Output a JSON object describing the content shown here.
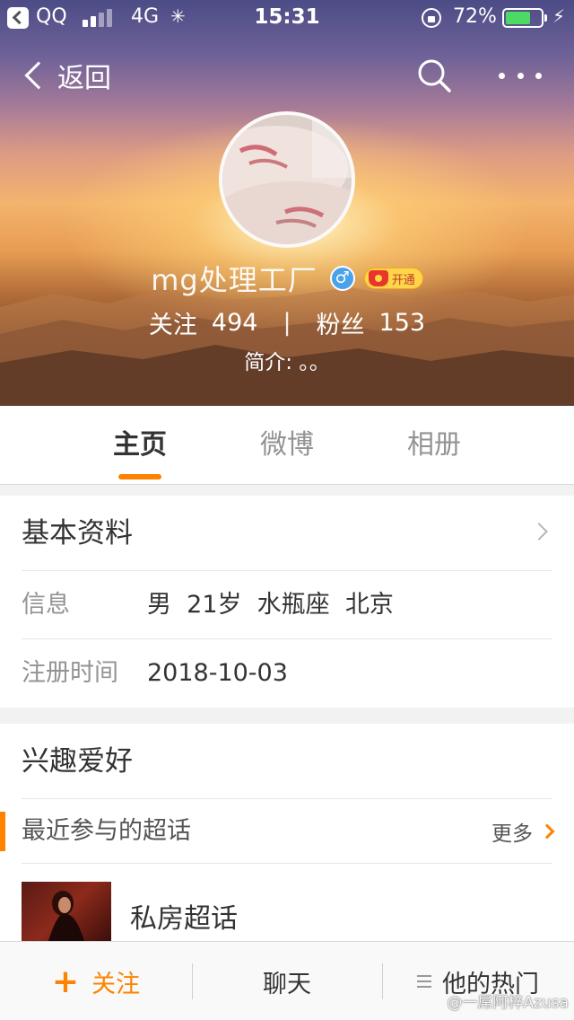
{
  "status_bar": {
    "app": "QQ",
    "network": "4G",
    "time": "15:31",
    "battery_percent": "72%",
    "battery_level": 0.72,
    "battery_color": "#4cd964"
  },
  "nav": {
    "back_label": "返回",
    "search_icon": "search-icon",
    "more_icon": "more-icon"
  },
  "profile": {
    "name": "mg处理工厂",
    "gender_icon": "male-icon",
    "vip_label": "开通",
    "following_label": "关注",
    "following_count": "494",
    "stats_divider": "|",
    "followers_label": "粉丝",
    "followers_count": "153",
    "bio": "简介: 。。"
  },
  "tabs": [
    {
      "label": "主页",
      "active": true
    },
    {
      "label": "微博",
      "active": false
    },
    {
      "label": "相册",
      "active": false
    }
  ],
  "basic_info": {
    "title": "基本资料",
    "rows": [
      {
        "label": "信息",
        "value": "男  21岁  水瓶座  北京"
      },
      {
        "label": "注册时间",
        "value": "2018-10-03"
      }
    ]
  },
  "interests": {
    "title": "兴趣爱好",
    "recent_topics_title": "最近参与的超话",
    "more_label": "更多",
    "topics": [
      {
        "name": "私房超话"
      }
    ]
  },
  "toolbar": {
    "follow_plus": "+",
    "follow_label": "关注",
    "chat_label": "聊天",
    "hot_label": "他的热门"
  },
  "watermark": "@一屌阿梓Azusa",
  "colors": {
    "accent": "#ff8200",
    "muted_text": "#939393"
  }
}
